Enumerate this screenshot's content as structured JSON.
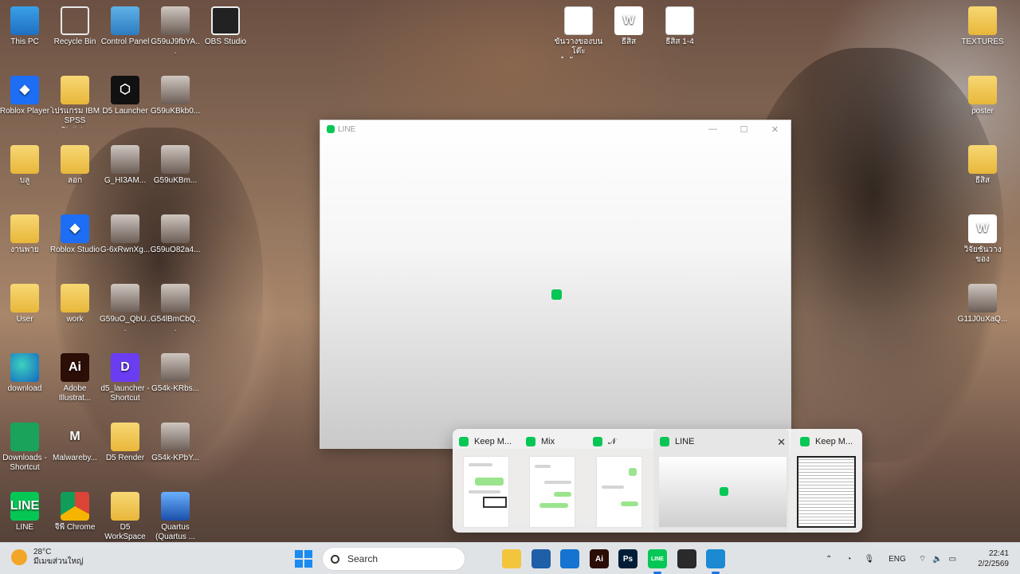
{
  "desktop": {
    "icons": [
      {
        "label": "This PC",
        "glyph": "pc"
      },
      {
        "label": "Recycle Bin",
        "glyph": "bin"
      },
      {
        "label": "Control Panel",
        "glyph": "cp"
      },
      {
        "label": "G59uJ9fbYA...",
        "glyph": "photo"
      },
      {
        "label": "OBS Studio",
        "glyph": "obs"
      },
      {
        "label": "ขั้นวางของบนโต๊ะสำนักงาน...",
        "glyph": "doc"
      },
      {
        "label": "ธีสิส",
        "glyph": "word"
      },
      {
        "label": "ธีสิส 1-4",
        "glyph": "doc"
      },
      {
        "label": "TEXTURES",
        "glyph": "folder"
      },
      {
        "label": "Roblox Player",
        "glyph": "roblox"
      },
      {
        "label": "โปรแกรม IBM SPSS Statist...",
        "glyph": "folder"
      },
      {
        "label": "D5 Launcher",
        "glyph": "d5"
      },
      {
        "label": "G59uKBkb0...",
        "glyph": "photo"
      },
      {
        "label": "poster",
        "glyph": "folder"
      },
      {
        "label": "บลู",
        "glyph": "folder"
      },
      {
        "label": "ลอก",
        "glyph": "folder"
      },
      {
        "label": "G_HI3AM...",
        "glyph": "photo"
      },
      {
        "label": "G59uKBm...",
        "glyph": "photo"
      },
      {
        "label": "ธีสิส",
        "glyph": "folder"
      },
      {
        "label": "งานพาย",
        "glyph": "folder"
      },
      {
        "label": "Roblox Studio",
        "glyph": "roblox"
      },
      {
        "label": "G-6xRwnXg...",
        "glyph": "photo"
      },
      {
        "label": "G59uO82a4...",
        "glyph": "photo"
      },
      {
        "label": "วิจัยชั้นวางของ",
        "glyph": "word"
      },
      {
        "label": "User",
        "glyph": "user"
      },
      {
        "label": "work",
        "glyph": "folder"
      },
      {
        "label": "G59uO_QbU...",
        "glyph": "photo"
      },
      {
        "label": "G54lBmCbQ...",
        "glyph": "photo"
      },
      {
        "label": "G11J0uXaQ...",
        "glyph": "photo"
      },
      {
        "label": "download",
        "glyph": "edge"
      },
      {
        "label": "Adobe Illustrat...",
        "glyph": "ai"
      },
      {
        "label": "d5_launcher - Shortcut",
        "glyph": "d5l"
      },
      {
        "label": "G54k-KRbs...",
        "glyph": "photo"
      },
      {
        "label": "Downloads - Shortcut",
        "glyph": "dl"
      },
      {
        "label": "Malwareby...",
        "glyph": "mb"
      },
      {
        "label": "D5 Render",
        "glyph": "folder"
      },
      {
        "label": "G54k-KPbY...",
        "glyph": "photo"
      },
      {
        "label": "LINE",
        "glyph": "line"
      },
      {
        "label": "จีพี Chrome",
        "glyph": "chrome"
      },
      {
        "label": "D5 WorkSpace",
        "glyph": "folder"
      },
      {
        "label": "Quartus (Quartus ...",
        "glyph": "quartus"
      }
    ],
    "glyph_text": {
      "ai": "Ai",
      "line": "LINE",
      "d5l": "D",
      "roblox": "◆",
      "d5": "⬡",
      "word": "W",
      "mb": "M"
    }
  },
  "line_window": {
    "title": "LINE",
    "minimize": "—",
    "maximize": "☐",
    "close": "✕"
  },
  "taskbar_preview": {
    "thumbnails": [
      {
        "title": "Keep M..."
      },
      {
        "title": "Mix"
      },
      {
        "title": "𝒩"
      },
      {
        "title": "LINE",
        "close": "✕"
      },
      {
        "title": "Keep M..."
      }
    ]
  },
  "taskbar": {
    "weather_temp": "28°C",
    "weather_desc": "มีเมฆส่วนใหญ่",
    "search_placeholder": "Search",
    "apps": [
      {
        "name": "File Explorer",
        "color": "#f2c53d",
        "text": ""
      },
      {
        "name": "Visual Studio",
        "color": "#1e5fa8",
        "text": ""
      },
      {
        "name": "Microsoft Store",
        "color": "#1573d1",
        "text": ""
      },
      {
        "name": "Adobe Illustrator",
        "color": "#2b0e06",
        "text": "Ai"
      },
      {
        "name": "Photoshop",
        "color": "#001e36",
        "text": "Ps"
      },
      {
        "name": "LINE",
        "color": "#06c755",
        "text": "LINE"
      },
      {
        "name": "OBS Studio",
        "color": "#2a2a2a",
        "text": ""
      },
      {
        "name": "Edge",
        "color": "#1b8ad3",
        "text": ""
      }
    ],
    "language": "ENG",
    "time": "22:41",
    "date": "2/2/2569"
  }
}
